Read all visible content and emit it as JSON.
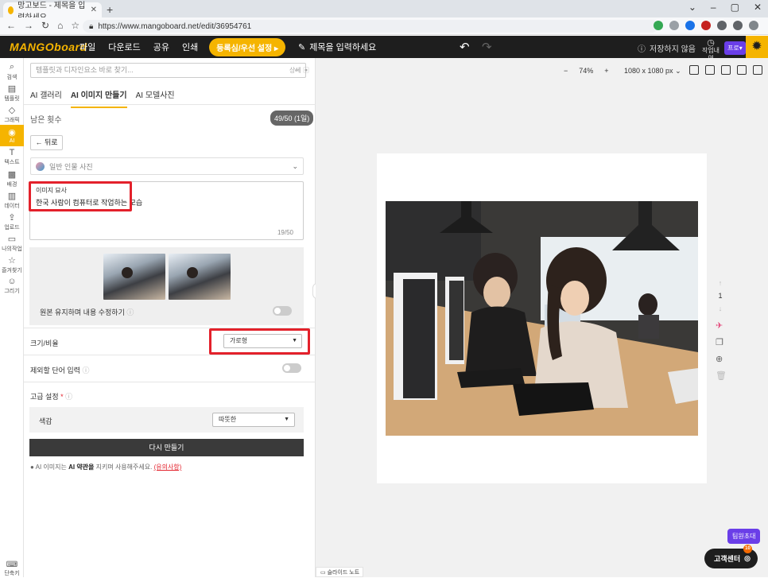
{
  "browser": {
    "tab_title": "망고보드 - 제목을 입력하세요",
    "url": "https://www.mangoboard.net/edit/36954761"
  },
  "header": {
    "logo": "MANGOboard",
    "menu": [
      "파일",
      "다운로드",
      "공유",
      "인쇄"
    ],
    "share_button": "등록심/우선 설정",
    "title_placeholder": "제목을 입력하세요",
    "save_status": "저장하지 않음",
    "history_label": "작업내역",
    "plan_badge": "프로"
  },
  "rail": [
    {
      "icon": "search-icon",
      "glyph": "⌕",
      "label": "검색"
    },
    {
      "icon": "template-icon",
      "glyph": "▤",
      "label": "템플릿"
    },
    {
      "icon": "elements-icon",
      "glyph": "◇",
      "label": "그래픽"
    },
    {
      "icon": "ai-icon",
      "glyph": "◉",
      "label": "AI",
      "active": true
    },
    {
      "icon": "text-icon",
      "glyph": "T",
      "label": "텍스트"
    },
    {
      "icon": "background-icon",
      "glyph": "▩",
      "label": "배경"
    },
    {
      "icon": "chart-icon",
      "glyph": "▥",
      "label": "데이터"
    },
    {
      "icon": "upload-icon",
      "glyph": "⇪",
      "label": "업로드"
    },
    {
      "icon": "my-work-icon",
      "glyph": "▭",
      "label": "나의작업"
    },
    {
      "icon": "star-icon",
      "glyph": "☆",
      "label": "즐겨찾기"
    },
    {
      "icon": "draw-icon",
      "glyph": "☺",
      "label": "그리기"
    }
  ],
  "rail_bottom": "단축키",
  "panel": {
    "search_placeholder": "템플릿과 디자인요소 바로 찾기...",
    "detail_button": "상세",
    "tabs": [
      "AI 갤러리",
      "AI 이미지 만들기",
      "AI 모델사진"
    ],
    "active_tab": 1,
    "remain_label": "남은 횟수",
    "remain_value": "49/50 (1일)",
    "back_button": "뒤로",
    "style_select": "일반 인물 사진",
    "description_label": "이미지 묘사",
    "description_text": "한국 사람이 컴퓨터로 작업하는 모습",
    "description_count": "19/50",
    "keep_original_label": "원본 유지하며 내용 수정하기",
    "size_label": "크기/비율",
    "size_value": "가로형",
    "exclude_label": "제외할 단어 입력",
    "advanced_label": "고급 설정",
    "tone_label": "색감",
    "tone_value": "따뜻한",
    "regenerate_button": "다시 만들기",
    "notice_prefix": "AI 이미지는",
    "notice_bold": "AI 약관을",
    "notice_suffix": "지키며 사용해주세요.",
    "notice_link": "(유의사항)"
  },
  "canvas": {
    "zoom": "74%",
    "page_size": "1080 x 1080 px",
    "page_number": "1",
    "slide_note": "슬라이드 노트",
    "tooltip": "팀원초대",
    "support_button": "고객센터",
    "support_badge": "10"
  }
}
